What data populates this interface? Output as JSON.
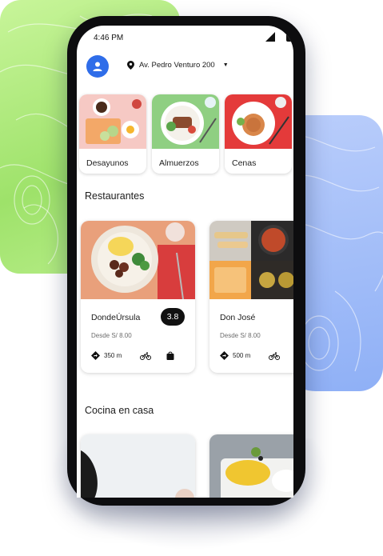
{
  "status_bar": {
    "time": "4:46 PM"
  },
  "header": {
    "address": "Av. Pedro Venturo 200"
  },
  "categories": [
    {
      "label": "Desayunos"
    },
    {
      "label": "Almuerzos"
    },
    {
      "label": "Cenas"
    }
  ],
  "restaurants_section": {
    "title": "Restaurantes"
  },
  "restaurants": [
    {
      "name": "DondeÚrsula",
      "rating": "3.8",
      "price": "Desde S/ 8.00",
      "distance": "350 m"
    },
    {
      "name": "Don José",
      "price": "Desde S/ 8.00",
      "distance": "500 m"
    }
  ],
  "home_section": {
    "title": "Cocina en casa"
  },
  "colors": {
    "accent": "#2f6de9",
    "green_blob": "#a8e878",
    "blue_blob": "#9bb8f7"
  },
  "icons": [
    "user-icon",
    "location-pin-icon",
    "chevron-down-icon",
    "directions-icon",
    "bicycle-icon",
    "shopping-bag-icon"
  ]
}
